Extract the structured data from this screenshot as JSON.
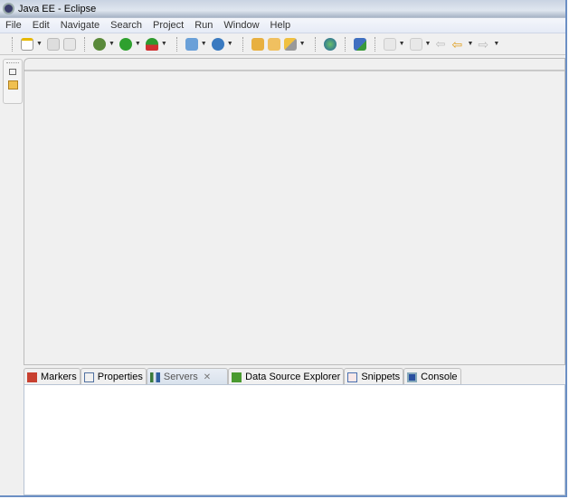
{
  "window": {
    "title": "Java EE - Eclipse"
  },
  "menu": [
    "File",
    "Edit",
    "Navigate",
    "Search",
    "Project",
    "Run",
    "Window",
    "Help"
  ],
  "toolbar": {
    "icons": [
      "new-icon",
      "save-icon",
      "print-icon",
      "debug-icon",
      "run-icon",
      "external-tools-icon",
      "new-server-icon",
      "new-web-service-icon",
      "open-project-icon",
      "open-folder-icon",
      "search-icon",
      "globe-icon",
      "run-on-server-icon",
      "next-annotation-icon",
      "previous-annotation-icon",
      "last-edit-icon",
      "back-icon",
      "forward-icon"
    ]
  },
  "bottom_tabs": [
    {
      "label": "Markers",
      "icon": "markers-icon",
      "color": "#c84030"
    },
    {
      "label": "Properties",
      "icon": "properties-icon",
      "color": "#5070a0"
    },
    {
      "label": "Servers",
      "icon": "servers-icon",
      "color": "#3a7a3a",
      "active": true,
      "close": "✕"
    },
    {
      "label": "Data Source Explorer",
      "icon": "data-source-icon",
      "color": "#4a9a30"
    },
    {
      "label": "Snippets",
      "icon": "snippets-icon",
      "color": "#4a70b0"
    },
    {
      "label": "Console",
      "icon": "console-icon",
      "color": "#2a50a0"
    }
  ]
}
